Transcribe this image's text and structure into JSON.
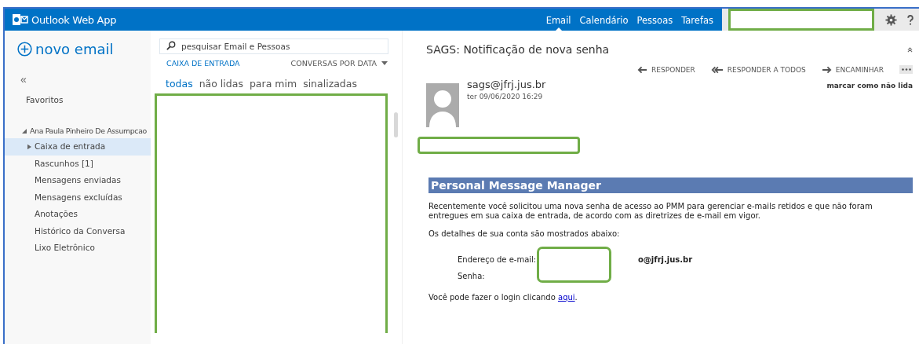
{
  "app_title": "Outlook Web App",
  "nav_tabs": [
    {
      "label": "Email",
      "selected": true
    },
    {
      "label": "Calendário",
      "selected": false
    },
    {
      "label": "Pessoas",
      "selected": false
    },
    {
      "label": "Tarefas",
      "selected": false
    }
  ],
  "new_email": "novo email",
  "collapse_glyph": "«",
  "favorites": "Favoritos",
  "folder_tree": {
    "label": "Ana Paula Pinheiro De Assumpcao",
    "expanded": true,
    "children": [
      {
        "label": "Caixa de entrada",
        "selected": true,
        "has_children": true
      },
      {
        "label": "Rascunhos [1]",
        "selected": false,
        "has_children": false
      },
      {
        "label": "Mensagens enviadas",
        "selected": false,
        "has_children": false
      },
      {
        "label": "Mensagens excluídas",
        "selected": false,
        "has_children": false
      },
      {
        "label": "Anotações",
        "selected": false,
        "has_children": false
      },
      {
        "label": "Histórico da Conversa",
        "selected": false,
        "has_children": false
      },
      {
        "label": "Lixo Eletrônico",
        "selected": false,
        "has_children": false
      }
    ]
  },
  "search": {
    "placeholder": "pesquisar Email e Pessoas"
  },
  "list": {
    "folder": "CAIXA DE ENTRADA",
    "sort": "CONVERSAS POR DATA",
    "filters": [
      {
        "label": "todas",
        "selected": true
      },
      {
        "label": "não lidas",
        "selected": false
      },
      {
        "label": "para mim",
        "selected": false
      },
      {
        "label": "sinalizadas",
        "selected": false
      }
    ]
  },
  "message": {
    "subject": "SAGS: Notificação de nova senha",
    "actions": [
      {
        "label": "RESPONDER",
        "kind": "reply"
      },
      {
        "label": "RESPONDER A TODOS",
        "kind": "reply_all"
      },
      {
        "label": "ENCAMINHAR",
        "kind": "forward"
      }
    ],
    "mark_unread": "marcar como não lida",
    "sender": "sags@jfrj.jus.br",
    "date": "ter 09/06/2020 16:29",
    "heading": "Personal Message Manager",
    "paragraph_1": "Recentemente você solicitou uma nova senha de acesso ao PMM para gerenciar e-mails retidos e que não foram entregues em sua caixa de entrada, de acordo com as diretrizes de e-mail em vigor.",
    "paragraph_2": "Os detalhes de sua conta são mostrados abaixo:",
    "fields": [
      {
        "label": "Endereço de e-mail:",
        "value": "o@jfrj.jus.br"
      },
      {
        "label": "Senha:"
      }
    ],
    "login_text": "Você pode fazer o login clicando",
    "login_link": "aqui",
    "login_end": "."
  }
}
